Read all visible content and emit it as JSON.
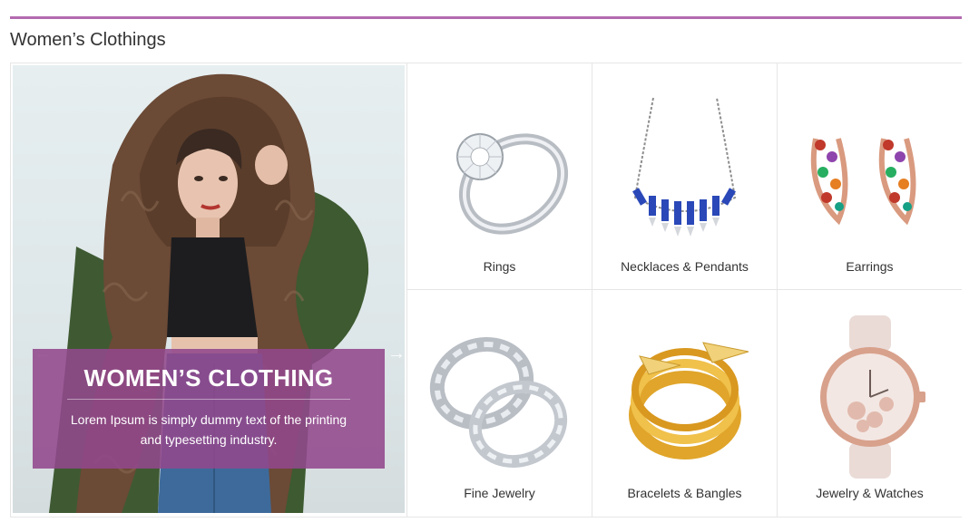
{
  "section": {
    "title": "Women’s Clothings",
    "accent_color": "#b36bb0"
  },
  "banner": {
    "prev_icon": "arrow-left-icon",
    "next_icon": "arrow-right-icon",
    "promo_title": "WOMEN’S CLOTHING",
    "promo_text": "Lorem Ipsum is simply dummy text of the printing and typesetting industry.",
    "promo_color": "#92488c"
  },
  "categories": [
    {
      "label": "Rings",
      "icon": "ring-icon"
    },
    {
      "label": "Necklaces & Pendants",
      "icon": "necklace-icon"
    },
    {
      "label": "Earrings",
      "icon": "earrings-icon"
    },
    {
      "label": "Fine Jewelry",
      "icon": "wedding-bands-icon"
    },
    {
      "label": "Bracelets & Bangles",
      "icon": "bangle-icon"
    },
    {
      "label": "Jewelry & Watches",
      "icon": "watch-icon"
    }
  ]
}
